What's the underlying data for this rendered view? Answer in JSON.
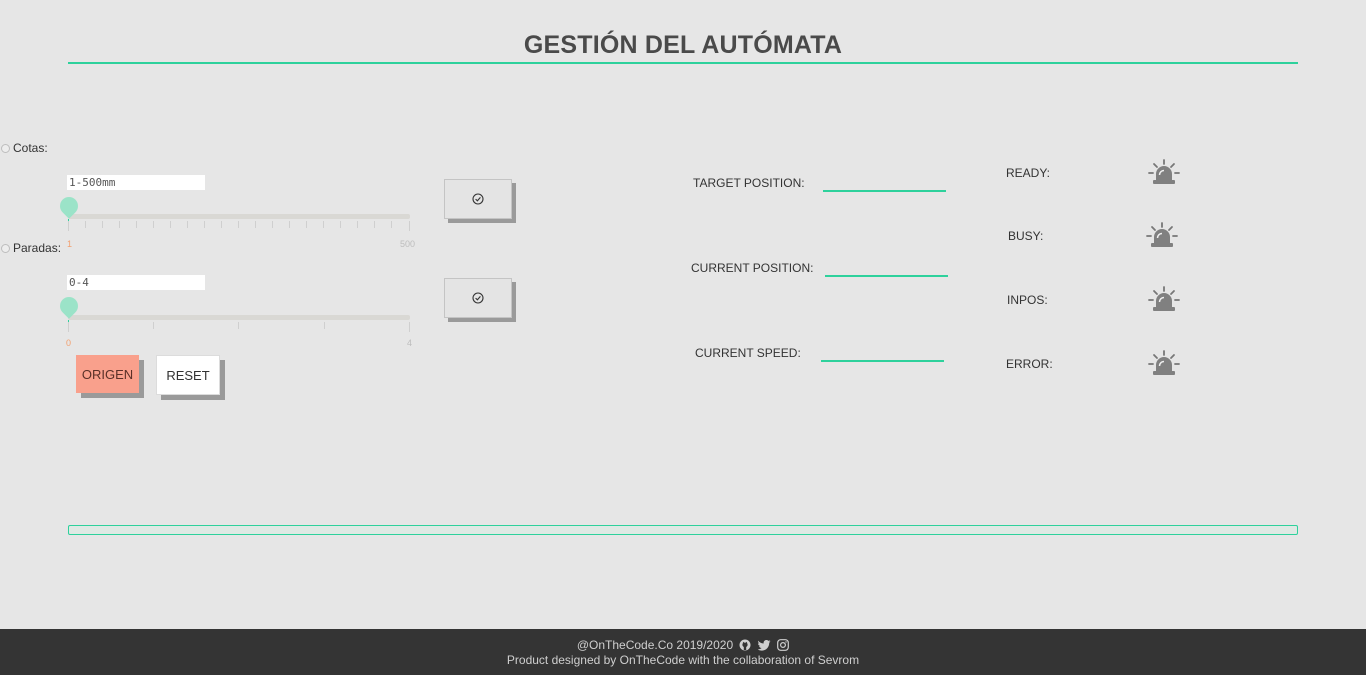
{
  "header": {
    "title": "GESTIÓN DEL AUTÓMATA"
  },
  "controls": {
    "cotas": {
      "label": "Cotas:",
      "input_value": "1-500mm",
      "slider": {
        "min": 1,
        "max": 500,
        "value": 1,
        "min_label": "1",
        "max_label": "500"
      },
      "confirm_icon": "check-circle-icon"
    },
    "paradas": {
      "label": "Paradas:",
      "input_value": "0-4",
      "slider": {
        "min": 0,
        "max": 4,
        "value": 0,
        "min_label": "0",
        "max_label": "4"
      },
      "confirm_icon": "check-circle-icon"
    },
    "origen_label": "ORIGEN",
    "reset_label": "RESET"
  },
  "fields": {
    "target_position": {
      "label": "TARGET POSITION:",
      "value": ""
    },
    "current_position": {
      "label": "CURRENT POSITION:",
      "value": ""
    },
    "current_speed": {
      "label": "CURRENT SPEED:",
      "value": ""
    }
  },
  "status": {
    "ready": {
      "label": "READY:",
      "icon": "alarm-light-icon"
    },
    "busy": {
      "label": "BUSY:",
      "icon": "alarm-light-icon"
    },
    "inpos": {
      "label": "INPOS:",
      "icon": "alarm-light-icon"
    },
    "error": {
      "label": "ERROR:",
      "icon": "alarm-light-icon"
    }
  },
  "progress": {
    "value": 0
  },
  "footer": {
    "line1": "@OnTheCode.Co 2019/2020",
    "line2": "Product designed by OnTheCode with the collaboration of Sevrom",
    "icons": [
      "github-icon",
      "twitter-icon",
      "instagram-icon"
    ]
  },
  "colors": {
    "accent": "#2ed19c",
    "origen": "#f9a08c",
    "footer_bg": "#343434",
    "background": "#e6e6e6"
  }
}
